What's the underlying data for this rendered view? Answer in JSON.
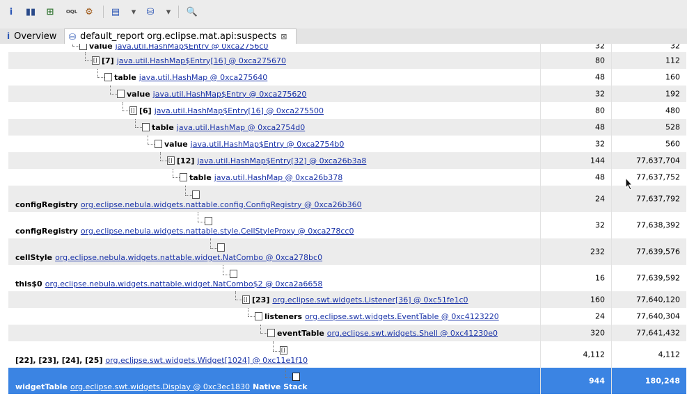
{
  "toolbar": {
    "buttons": [
      {
        "name": "info-icon",
        "glyph": "i",
        "color": "#2a55b5"
      },
      {
        "name": "histogram-icon",
        "glyph": "▮▮",
        "color": "#2a4a8a"
      },
      {
        "name": "dominator-tree-icon",
        "glyph": "⊞",
        "color": "#3a7a3a"
      },
      {
        "name": "oql-icon",
        "glyph": "OQL",
        "color": "#444"
      },
      {
        "name": "query-browser-icon",
        "glyph": "⚙",
        "color": "#a05a1a"
      },
      {
        "name": "heap-dump-overview-icon",
        "glyph": "▤",
        "color": "#2a55b5"
      },
      {
        "name": "heap-dump-dropdown-icon",
        "glyph": "▾",
        "color": "#555"
      },
      {
        "name": "database-icon",
        "glyph": "⛁",
        "color": "#2a55b5"
      },
      {
        "name": "database-dropdown-icon",
        "glyph": "▾",
        "color": "#555"
      },
      {
        "name": "search-icon",
        "glyph": "🔍",
        "color": "#444"
      }
    ]
  },
  "tabs": [
    {
      "label": "Overview",
      "icon": "i",
      "active": false
    },
    {
      "label": "default_report  org.eclipse.mat.api:suspects",
      "icon": "⛁",
      "active": true
    }
  ],
  "rows": [
    {
      "name": "value",
      "link": "java.util.HashMap$Entry @ 0xca2756c0",
      "shallow": "32",
      "retained": "32"
    },
    {
      "name": "[7]",
      "link": "java.util.HashMap$Entry[16] @ 0xca275670",
      "shallow": "80",
      "retained": "112"
    },
    {
      "name": "table",
      "link": "java.util.HashMap @ 0xca275640",
      "shallow": "48",
      "retained": "160"
    },
    {
      "name": "value",
      "link": "java.util.HashMap$Entry @ 0xca275620",
      "shallow": "32",
      "retained": "192"
    },
    {
      "name": "[6]",
      "link": "java.util.HashMap$Entry[16] @ 0xca275500",
      "shallow": "80",
      "retained": "480"
    },
    {
      "name": "table",
      "link": "java.util.HashMap @ 0xca2754d0",
      "shallow": "48",
      "retained": "528"
    },
    {
      "name": "value",
      "link": "java.util.HashMap$Entry @ 0xca2754b0",
      "shallow": "32",
      "retained": "560"
    },
    {
      "name": "[12]",
      "link": "java.util.HashMap$Entry[32] @ 0xca26b3a8",
      "shallow": "144",
      "retained": "77,637,704"
    },
    {
      "name": "table",
      "link": "java.util.HashMap @ 0xca26b378",
      "shallow": "48",
      "retained": "77,637,752"
    },
    {
      "name": "configRegistry",
      "link": "org.eclipse.nebula.widgets.nattable.config.ConfigRegistry @ 0xca26b360",
      "shallow": "24",
      "retained": "77,637,792"
    },
    {
      "name": "configRegistry",
      "link": "org.eclipse.nebula.widgets.nattable.style.CellStyleProxy @ 0xca278cc0",
      "shallow": "32",
      "retained": "77,638,392"
    },
    {
      "name": "cellStyle",
      "link": "org.eclipse.nebula.widgets.nattable.widget.NatCombo @ 0xca278bc0",
      "shallow": "232",
      "retained": "77,639,576"
    },
    {
      "name": "this$0",
      "link": "org.eclipse.nebula.widgets.nattable.widget.NatCombo$2 @ 0xca2a6658",
      "shallow": "16",
      "retained": "77,639,592"
    },
    {
      "name": "[23]",
      "link": "org.eclipse.swt.widgets.Listener[36] @ 0xc51fe1c0",
      "shallow": "160",
      "retained": "77,640,120"
    },
    {
      "name": "listeners",
      "link": "org.eclipse.swt.widgets.EventTable @ 0xc4123220",
      "shallow": "24",
      "retained": "77,640,304"
    },
    {
      "name": "eventTable",
      "link": "org.eclipse.swt.widgets.Shell @ 0xc41230e0",
      "shallow": "320",
      "retained": "77,641,432"
    },
    {
      "name": "[22], [23], [24], [25]",
      "link": "org.eclipse.swt.widgets.Widget[1024] @ 0xc11e1f10",
      "shallow": "4,112",
      "retained": "4,112"
    },
    {
      "name": "widgetTable",
      "link": "org.eclipse.swt.widgets.Display @ 0xc3ec1830",
      "tail": "Native Stack",
      "shallow": "944",
      "retained": "180,248"
    }
  ]
}
